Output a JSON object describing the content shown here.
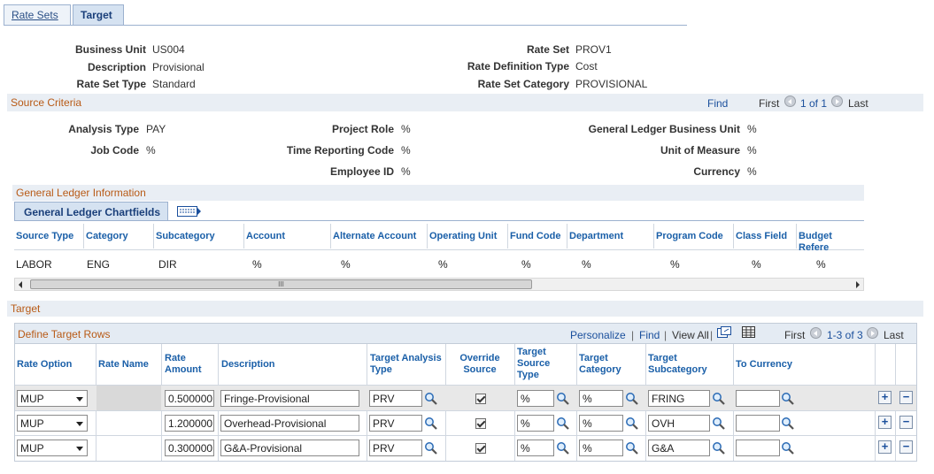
{
  "tabs": [
    {
      "label": "Rate Sets"
    },
    {
      "label": "Target"
    }
  ],
  "header": {
    "business_unit_label": "Business Unit",
    "business_unit": "US004",
    "description_label": "Description",
    "description": "Provisional",
    "rate_set_type_label": "Rate Set Type",
    "rate_set_type": "Standard",
    "rate_set_label": "Rate Set",
    "rate_set": "PROV1",
    "rate_def_type_label": "Rate Definition Type",
    "rate_def_type": "Cost",
    "rate_set_category_label": "Rate Set Category",
    "rate_set_category": "PROVISIONAL"
  },
  "source_criteria": {
    "title": "Source Criteria",
    "find": "Find",
    "first": "First",
    "count": "1 of 1",
    "last": "Last",
    "analysis_type_label": "Analysis Type",
    "analysis_type": "PAY",
    "job_code_label": "Job Code",
    "job_code": "%",
    "project_role_label": "Project Role",
    "project_role": "%",
    "time_reporting_code_label": "Time Reporting Code",
    "time_reporting_code": "%",
    "employee_id_label": "Employee ID",
    "employee_id": "%",
    "gl_bu_label": "General Ledger Business Unit",
    "gl_bu": "%",
    "uom_label": "Unit of Measure",
    "uom": "%",
    "currency_label": "Currency",
    "currency": "%"
  },
  "gl_info": {
    "title": "General Ledger Information",
    "tab_label": "General Ledger Chartfields",
    "columns": [
      "Source Type",
      "Category",
      "Subcategory",
      "Account",
      "Alternate Account",
      "Operating Unit",
      "Fund Code",
      "Department",
      "Program Code",
      "Class Field",
      "Budget Refere"
    ],
    "row": [
      "LABOR",
      "ENG",
      "DIR",
      "%",
      "%",
      "%",
      "%",
      "%",
      "%",
      "%",
      "%"
    ],
    "scroll_grip": "III"
  },
  "target": {
    "title": "Target",
    "grid_title": "Define Target Rows",
    "personalize": "Personalize",
    "find": "Find",
    "view_all": "View All",
    "first": "First",
    "count": "1-3 of 3",
    "last": "Last",
    "columns": {
      "rate_option": "Rate Option",
      "rate_name": "Rate Name",
      "rate_amount": "Rate Amount",
      "description": "Description",
      "target_analysis_type": "Target Analysis Type",
      "override_source": "Override Source",
      "target_source_type": "Target Source Type",
      "target_category": "Target Category",
      "target_subcategory": "Target Subcategory",
      "to_currency": "To Currency"
    },
    "rows": [
      {
        "rate_option": "MUP",
        "rate_amount": "0.500000",
        "description": "Fringe-Provisional",
        "analysis_type": "PRV",
        "override": true,
        "source_type": "%",
        "category": "%",
        "subcategory": "FRING",
        "to_currency": ""
      },
      {
        "rate_option": "MUP",
        "rate_amount": "1.200000",
        "description": "Overhead-Provisional",
        "analysis_type": "PRV",
        "override": true,
        "source_type": "%",
        "category": "%",
        "subcategory": "OVH",
        "to_currency": ""
      },
      {
        "rate_option": "MUP",
        "rate_amount": "0.300000",
        "description": "G&A-Provisional",
        "analysis_type": "PRV",
        "override": true,
        "source_type": "%",
        "category": "%",
        "subcategory": "G&A",
        "to_currency": ""
      }
    ]
  },
  "colors": {
    "section": "#b85a16",
    "link": "#1a4f9c",
    "header_text": "#1a5fa8",
    "band": "#e9eef4"
  }
}
